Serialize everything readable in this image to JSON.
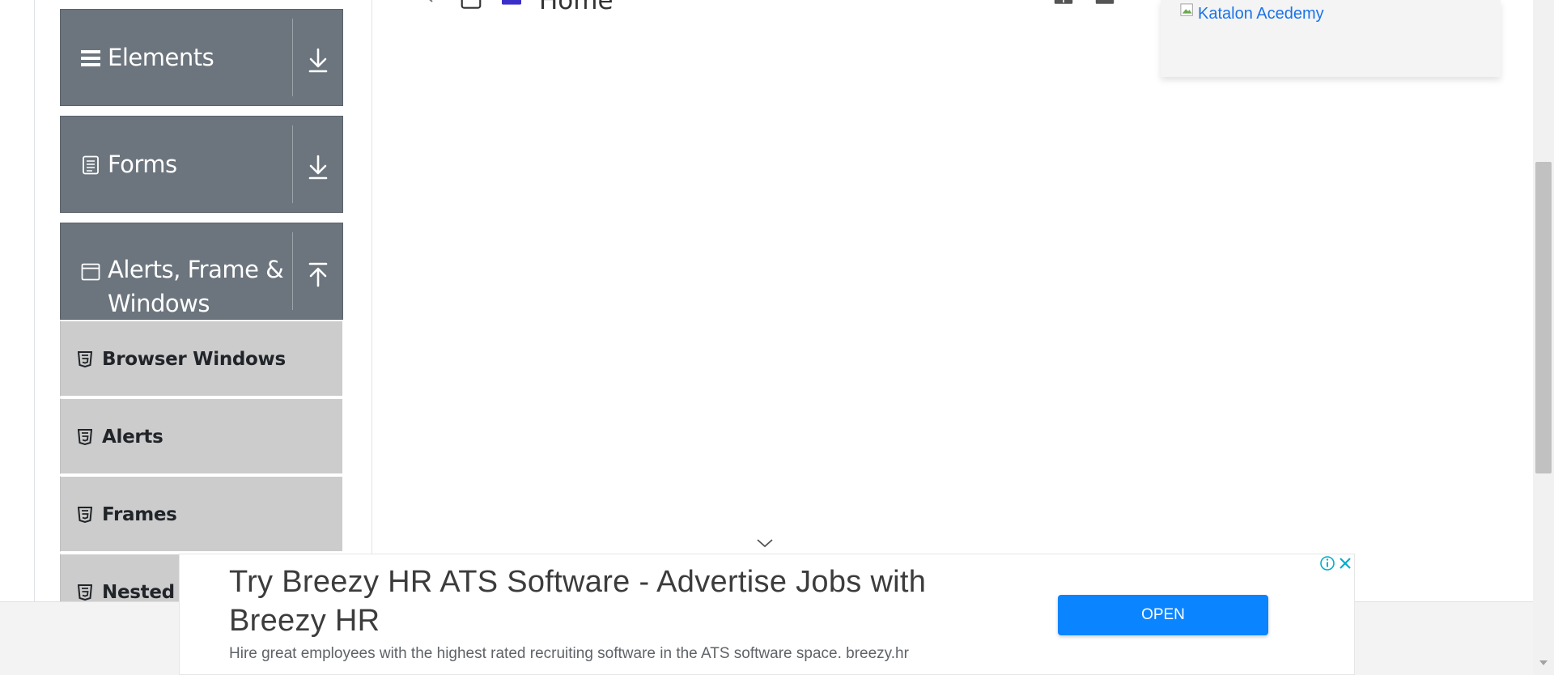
{
  "sidebar": {
    "groups": [
      {
        "label": "Elements",
        "icon": "hamburger-icon",
        "toggle": "download-arrow-icon"
      },
      {
        "label": "Forms",
        "icon": "document-icon",
        "toggle": "download-arrow-icon"
      },
      {
        "label_line1": "Alerts, Frame &",
        "label_line2": "Windows",
        "icon": "window-icon",
        "toggle": "upload-arrow-icon"
      }
    ],
    "items": [
      {
        "label": "Browser Windows",
        "icon": "html5-icon"
      },
      {
        "label": "Alerts",
        "icon": "html5-icon"
      },
      {
        "label": "Frames",
        "icon": "html5-icon"
      },
      {
        "label": "Nested F",
        "icon": "html5-icon"
      }
    ]
  },
  "tree": {
    "home_label": "Home"
  },
  "katalon": {
    "link_text": "Katalon Acedemy"
  },
  "ad": {
    "headline": "Try Breezy HR ATS Software - Advertise Jobs with Breezy HR",
    "description": "Hire great employees with the highest rated recruiting software in the ATS software space. breezy.hr",
    "cta": "OPEN"
  },
  "colors": {
    "header_bg": "#6c757d",
    "item_bg": "#cccccc",
    "cta_bg": "#0a84ff",
    "link": "#1a73e8"
  }
}
